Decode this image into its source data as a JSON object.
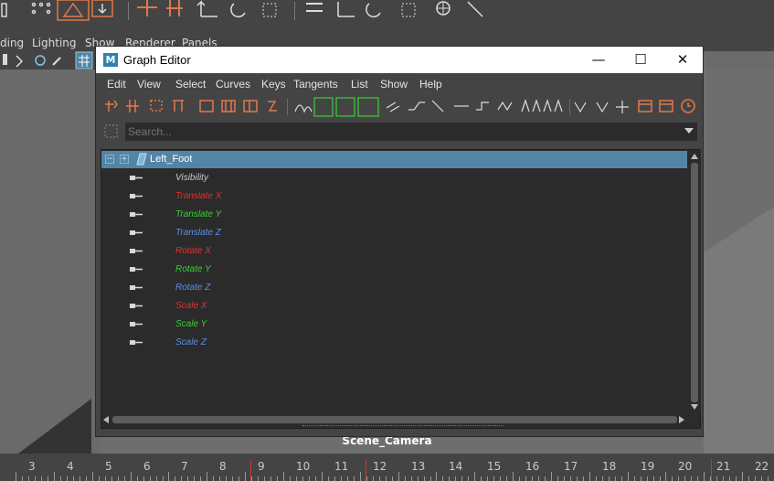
{
  "main_menu": {
    "items": [
      "ding",
      "Lighting",
      "Show",
      "Renderer",
      "Panels"
    ]
  },
  "graph_editor": {
    "title": "Graph Editor",
    "logo": "M",
    "window_buttons": {
      "minimize": "—",
      "maximize": "☐",
      "close": "✕"
    },
    "menu": [
      "Edit",
      "View",
      "Select",
      "Curves",
      "Keys",
      "Tangents",
      "List",
      "Show",
      "Help"
    ],
    "search": {
      "placeholder": "Search..."
    },
    "node": {
      "label": "Left_Foot"
    },
    "attributes": [
      {
        "name": "Visibility",
        "color": "#c8c8c8"
      },
      {
        "name": "Translate X",
        "color": "#e03030"
      },
      {
        "name": "Translate Y",
        "color": "#38d038"
      },
      {
        "name": "Translate Z",
        "color": "#5a8ee6"
      },
      {
        "name": "Rotate X",
        "color": "#e03030"
      },
      {
        "name": "Rotate Y",
        "color": "#38d038"
      },
      {
        "name": "Rotate Z",
        "color": "#5a8ee6"
      },
      {
        "name": "Scale X",
        "color": "#e03030"
      },
      {
        "name": "Scale Y",
        "color": "#38d038"
      },
      {
        "name": "Scale Z",
        "color": "#5a8ee6"
      }
    ]
  },
  "viewport": {
    "camera_label": "Scene_Camera"
  },
  "timeline": {
    "ticks": [
      "3",
      "4",
      "5",
      "6",
      "7",
      "8",
      "9",
      "10",
      "11",
      "12",
      "13",
      "14",
      "15",
      "16",
      "17",
      "18",
      "19",
      "20",
      "21",
      "22"
    ]
  },
  "colors": {
    "accent": "#5285a6",
    "panel": "#444444",
    "field": "#2b2b2b",
    "tool_orange": "#e0784a"
  }
}
